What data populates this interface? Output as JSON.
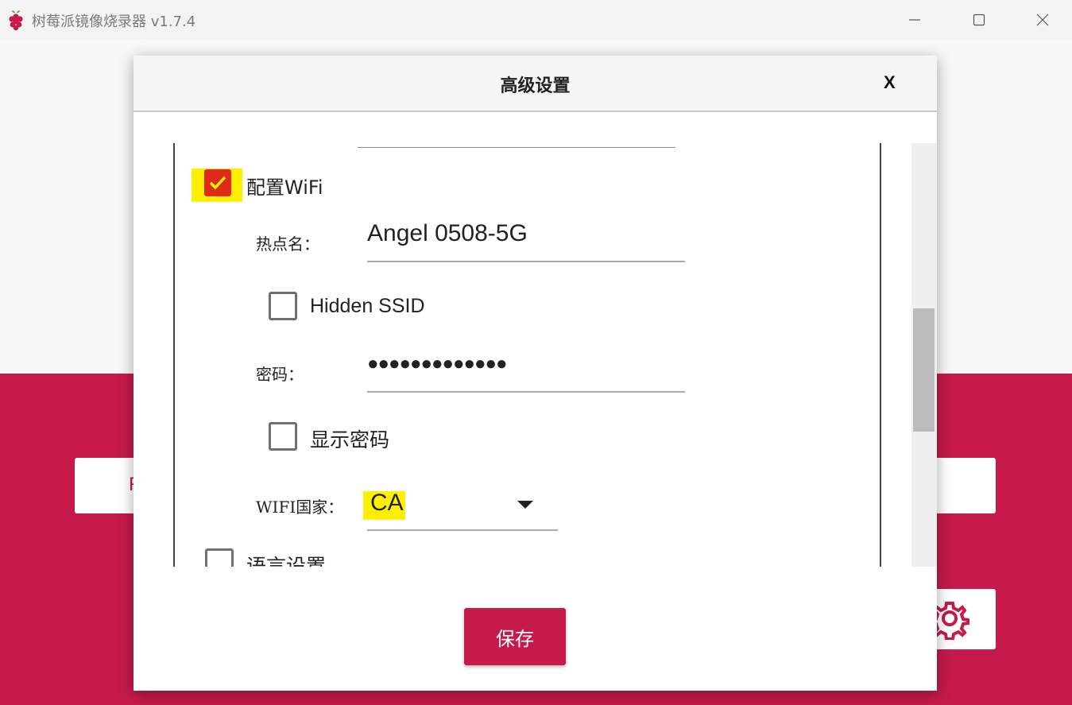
{
  "window": {
    "title": "树莓派镜像烧录器 v1.7.4",
    "controls": [
      "minimize",
      "maximize",
      "close"
    ]
  },
  "background": {
    "left_button_label": "R",
    "gear_icon": "gear-icon"
  },
  "dialog": {
    "title": "高级设置",
    "close_label": "X",
    "wifi_section": {
      "checkbox_label": "配置WiFi",
      "checked": true,
      "ssid_label": "热点名：",
      "ssid_value": "Angel 0508-5G",
      "hidden_ssid_label": "Hidden SSID",
      "hidden_ssid_checked": false,
      "password_label": "密码：",
      "password_value": "●●●●●●●●●●●●●",
      "show_password_label": "显示密码",
      "show_password_checked": false,
      "country_label": "WIFI国家：",
      "country_value": "CA"
    },
    "language_section": {
      "checkbox_label": "语言设置",
      "checked": false
    },
    "save_label": "保存"
  },
  "colors": {
    "accent": "#c51a4a",
    "checkbox_checked": "#e02a1a",
    "highlight": "#fff000"
  }
}
